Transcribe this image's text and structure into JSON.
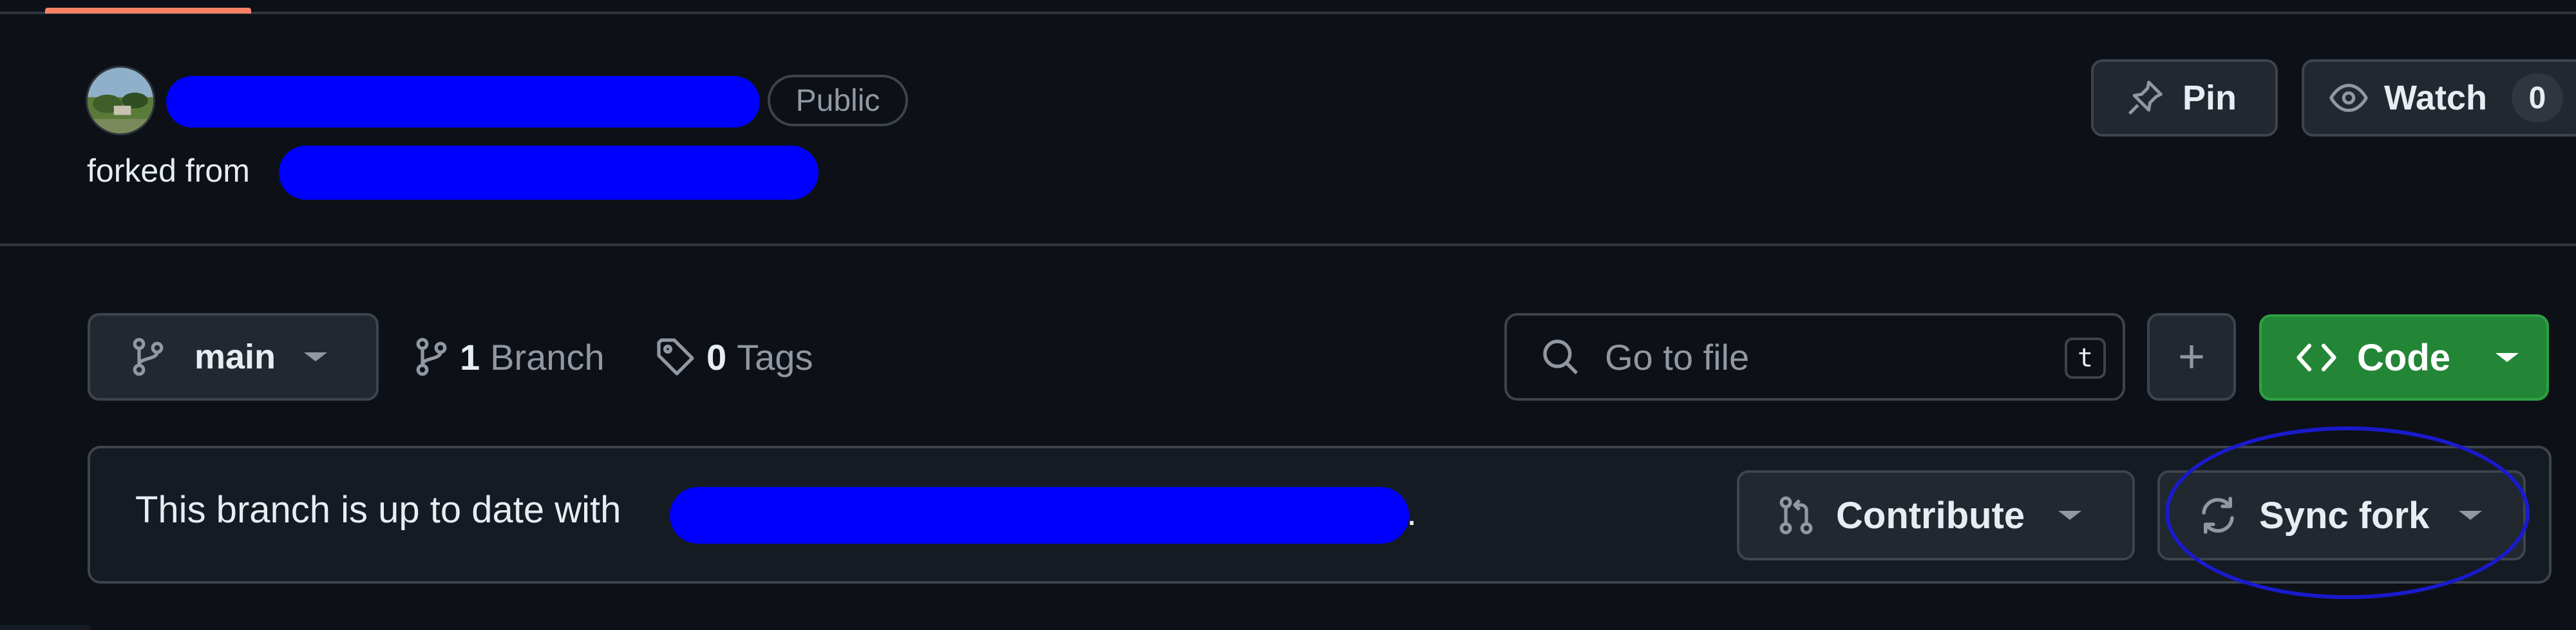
{
  "repo": {
    "visibility_badge": "Public",
    "forked_from_label": "forked from"
  },
  "header_actions": {
    "pin_label": "Pin",
    "watch_label": "Watch",
    "watch_count": "0"
  },
  "branch_bar": {
    "current_branch": "main",
    "branch_count": "1",
    "branch_label": "Branch",
    "tag_count": "0",
    "tag_label": "Tags",
    "goto_file_placeholder": "Go to file",
    "goto_file_shortcut": "t",
    "add_file_label": "+",
    "code_label": "Code"
  },
  "status": {
    "text": "This branch is up to date with",
    "period": ".",
    "contribute_label": "Contribute",
    "sync_fork_label": "Sync fork"
  },
  "colors": {
    "background": "#0d1117",
    "border": "#3d444d",
    "code_button": "#238636",
    "redaction": "#0000ff",
    "annotation": "#1a1acc",
    "tab_accent": "#f78166"
  },
  "icons": [
    "avatar",
    "pin-icon",
    "eye-icon",
    "git-branch-icon",
    "tag-icon",
    "search-icon",
    "code-icon",
    "git-pull-request-icon",
    "sync-icon",
    "caret-down-icon"
  ]
}
